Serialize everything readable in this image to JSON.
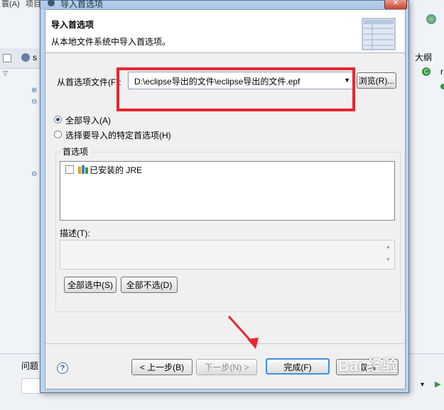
{
  "background": {
    "menu_items": [
      "蓑(A)",
      "项目"
    ],
    "editor_tab_label": "s",
    "outline_tab_label": "大纲",
    "outline_node_label": "r",
    "problems_tab_label": "问题"
  },
  "dialog": {
    "window_title": "导入首选项",
    "close_label": "✕",
    "header": {
      "title": "导入首选项",
      "description": "从本地文件系统中导入首选项。"
    },
    "file": {
      "label": "从首选项文件(F):",
      "value": "D:\\eclipse导出的文件\\eclipse导出的文件.epf",
      "browse_label": "浏览(R)..."
    },
    "options": [
      {
        "label": "全部导入(A)",
        "selected": true
      },
      {
        "label": "选择要导入的特定首选项(H)",
        "selected": false
      }
    ],
    "preferences": {
      "group_label": "首选项",
      "items": [
        {
          "label": "已安装的 JRE",
          "checked": false
        }
      ],
      "description_label": "描述(T):",
      "select_all_label": "全部选中(S)",
      "deselect_all_label": "全部不选(D)"
    },
    "footer": {
      "help_label": "?",
      "back_label": "< 上一步(B)",
      "next_label": "下一步(N) >",
      "finish_label": "完成(F)",
      "cancel_label": "取消"
    }
  },
  "watermark": "Bai 经验",
  "colors": {
    "highlight_box": "#e8272f",
    "arrow": "#e8272f",
    "accent": "#3c8fdc"
  }
}
